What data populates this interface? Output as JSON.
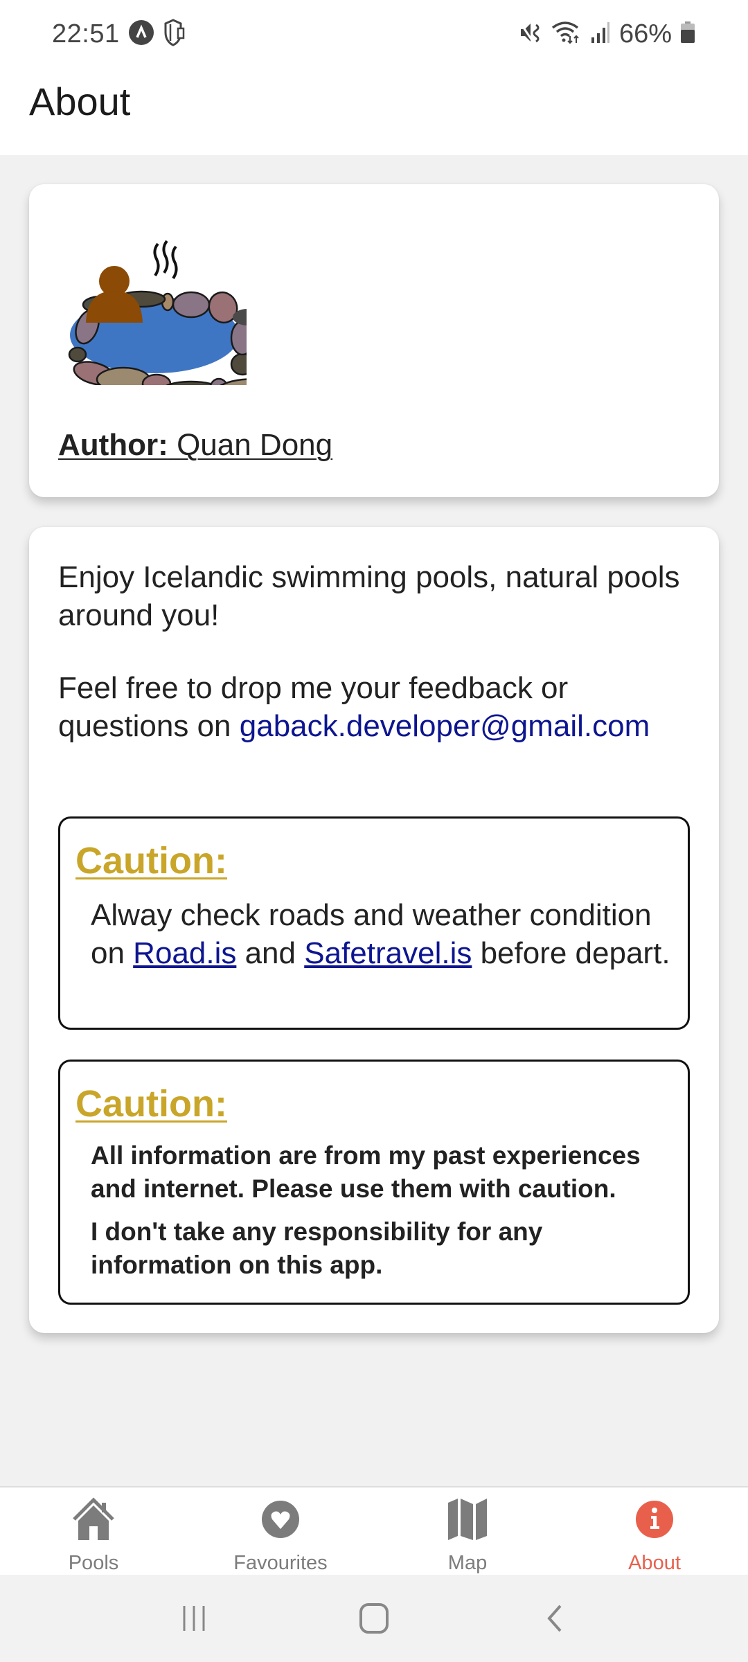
{
  "status_bar": {
    "time": "22:51",
    "left_icons": [
      "app-notification-icon",
      "secure-folder-icon"
    ],
    "right_icons": [
      "mute-icon",
      "wifi-icon",
      "signal-icon",
      "battery-icon"
    ],
    "battery_percent": "66%"
  },
  "header": {
    "title": "About"
  },
  "author_card": {
    "logo": "hot-spring-logo",
    "author_label": "Author:",
    "author_name": " Quan Dong"
  },
  "info_card": {
    "intro": "Enjoy Icelandic swimming pools, natural pools around you!",
    "feedback_text": "Feel free to drop me your feedback or questions on ",
    "email": "gaback.developer@gmail.com",
    "caution_1": {
      "title": "Caution:",
      "text_before": "Alway check roads and weather condition on ",
      "link_1": "Road.is",
      "text_middle": " and ",
      "link_2": "Safetravel.is",
      "text_after": " before depart."
    },
    "caution_2": {
      "title": "Caution:",
      "line_1": "All information are from my past experiences and internet. Please use them with caution.",
      "line_2": "I don't take any responsibility for any information on this app."
    }
  },
  "tabs": [
    {
      "label": "Pools",
      "icon": "home-icon",
      "active": false
    },
    {
      "label": "Favourites",
      "icon": "heart-icon",
      "active": false
    },
    {
      "label": "Map",
      "icon": "map-icon",
      "active": false
    },
    {
      "label": "About",
      "icon": "info-icon",
      "active": true
    }
  ],
  "colors": {
    "accent": "#e8604c",
    "inactive": "#7c7c7c",
    "link": "#0d1590",
    "caution": "#c9a629"
  },
  "system_nav": [
    "recents-button",
    "home-button",
    "back-button"
  ]
}
